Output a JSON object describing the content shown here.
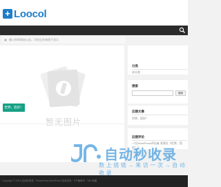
{
  "header": {
    "logo_plus": "+",
    "logo_text": "Loocol"
  },
  "breadcrumb": {
    "text": "输入你的网站公告，可在后台修改下显示"
  },
  "post": {
    "thumb_caption": "暂无图片",
    "title_button": "世界，您好！"
  },
  "sidebar": {
    "categories": {
      "title": "分类",
      "item": "未分类"
    },
    "search": {
      "title": "搜索",
      "button": "搜索"
    },
    "recent_posts": {
      "title": "近期文章",
      "item": "世界，您好！"
    },
    "recent_comments": {
      "title": "近期评论",
      "item": "一位WordPress评论者 发表在《世界，您好！》"
    }
  },
  "watermark": {
    "main": "自动秒收录",
    "sub": "数 上 搭 链 → 来 访 一 次 → 自 动 收 录"
  },
  "footer": {
    "text": "Copyright © 2024 自动秒收录 · Powered by WordPress 技术支持 · ICP备案号 · XML地图"
  },
  "colors": {
    "accent": "#17a085",
    "logo": "#1e7ec8",
    "navbar": "#2b2b2b",
    "watermark": "#5ea9e2"
  }
}
